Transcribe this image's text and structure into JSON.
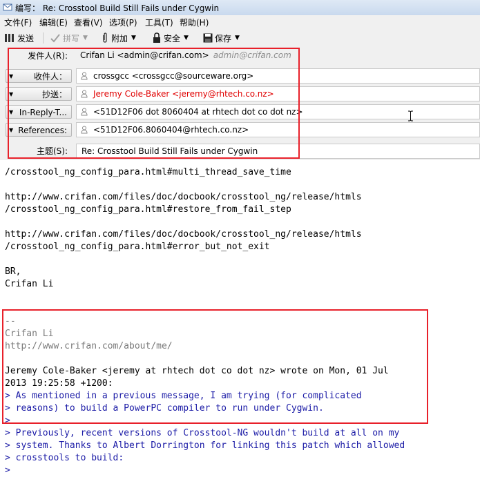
{
  "window": {
    "title": "编写： Re: Crosstool Build Still Fails under Cygwin"
  },
  "menu": [
    "文件(F)",
    "编辑(E)",
    "查看(V)",
    "选项(P)",
    "工具(T)",
    "帮助(H)"
  ],
  "toolbar": {
    "send": "发送",
    "spell": "拼写",
    "attach": "附加",
    "security": "安全",
    "save": "保存"
  },
  "header": {
    "from_label": "发件人(R):",
    "from_value": "Crifan Li <admin@crifan.com>",
    "from_identity": "admin@crifan.com",
    "to_label": "收件人：",
    "to_value": "crossgcc <crossgcc@sourceware.org>",
    "cc_label": "抄送：",
    "cc_value": "Jeremy Cole-Baker <jeremy@rhtech.co.nz>",
    "irt_label": "In-Reply-T...",
    "irt_value": "<51D12F06 dot 8060404 at rhtech dot co dot nz>",
    "refs_label": "References:",
    "refs_value": "<51D12F06.8060404@rhtech.co.nz>",
    "subject_label": "主题(S):",
    "subject_value": "Re: Crosstool Build Still Fails under Cygwin"
  },
  "body": {
    "l0": "/crosstool_ng_config_para.html#multi_thread_save_time",
    "l1": "http://www.crifan.com/files/doc/docbook/crosstool_ng/release/htmls",
    "l2": "/crosstool_ng_config_para.html#restore_from_fail_step",
    "l3": "http://www.crifan.com/files/doc/docbook/crosstool_ng/release/htmls",
    "l4": "/crosstool_ng_config_para.html#error_but_not_exit",
    "l5": "BR,",
    "l6": "Crifan Li",
    "sig1": "--",
    "sig2": "Crifan Li",
    "sig3": "http://www.crifan.com/about/me/",
    "attr1": "Jeremy Cole-Baker <jeremy at rhtech dot co dot nz> wrote on Mon, 01 Jul",
    "attr2": "2013 19:25:58 +1200:",
    "q1": "> As mentioned in a previous message, I am trying (for complicated",
    "q2": "> reasons) to build a PowerPC compiler to run under Cygwin.",
    "q3": ">",
    "q4": "> Previously, recent versions of Crosstool-NG wouldn't build at all on my",
    "q5": "> system. Thanks to Albert Dorrington for linking this patch which allowed",
    "q6": "> crosstools to build:",
    "q7": ">"
  },
  "colors": {
    "highlight_box": "#e8202a",
    "quote_text": "#1a1aa6",
    "cc_text": "#e00000",
    "signature_text": "#7a7a7a"
  }
}
